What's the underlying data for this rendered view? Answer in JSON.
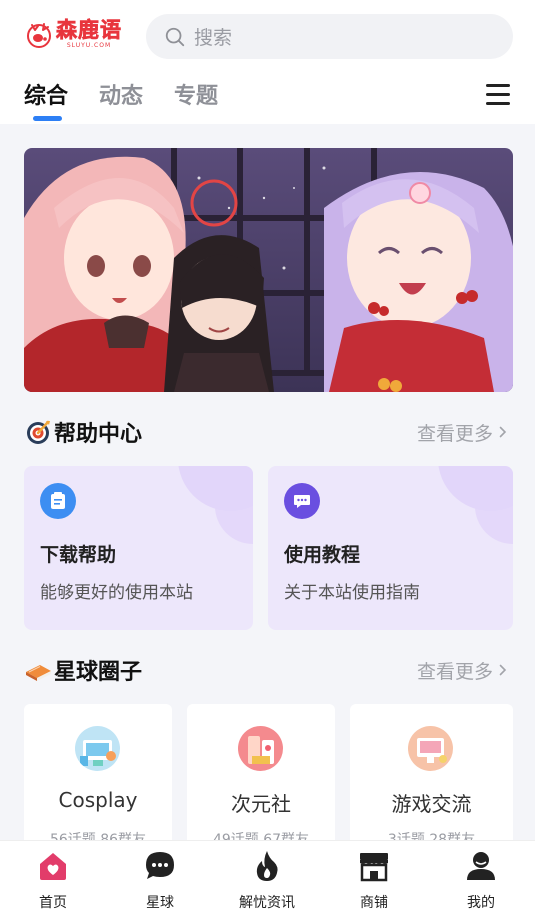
{
  "header": {
    "logo_text": "森鹿语",
    "logo_sub": "SLUYU.COM",
    "search_placeholder": "搜索",
    "tabs": [
      {
        "label": "综合",
        "active": true
      },
      {
        "label": "动态",
        "active": false
      },
      {
        "label": "专题",
        "active": false
      }
    ]
  },
  "help_section": {
    "title": "帮助中心",
    "more": "查看更多",
    "cards": [
      {
        "title": "下载帮助",
        "desc": "能够更好的使用本站",
        "icon": "document-icon",
        "icon_color": "#3d8ef2"
      },
      {
        "title": "使用教程",
        "desc": "关于本站使用指南",
        "icon": "chat-icon",
        "icon_color": "#6a4fe0"
      }
    ]
  },
  "circle_section": {
    "title": "星球圈子",
    "more": "查看更多",
    "cards": [
      {
        "name": "Cosplay",
        "stats": "56话题 86群友"
      },
      {
        "name": "次元社",
        "stats": "49话题 67群友"
      },
      {
        "name": "游戏交流",
        "stats": "3话题 28群友"
      }
    ]
  },
  "bottom_nav": [
    {
      "label": "首页",
      "icon": "home-icon",
      "active": true
    },
    {
      "label": "星球",
      "icon": "message-icon",
      "active": false
    },
    {
      "label": "解忧资讯",
      "icon": "flame-icon",
      "active": false
    },
    {
      "label": "商铺",
      "icon": "store-icon",
      "active": false
    },
    {
      "label": "我的",
      "icon": "user-icon",
      "active": false
    }
  ],
  "colors": {
    "accent": "#2d7ff5",
    "brand": "#e8353d",
    "home_active": "#e23c6a"
  }
}
